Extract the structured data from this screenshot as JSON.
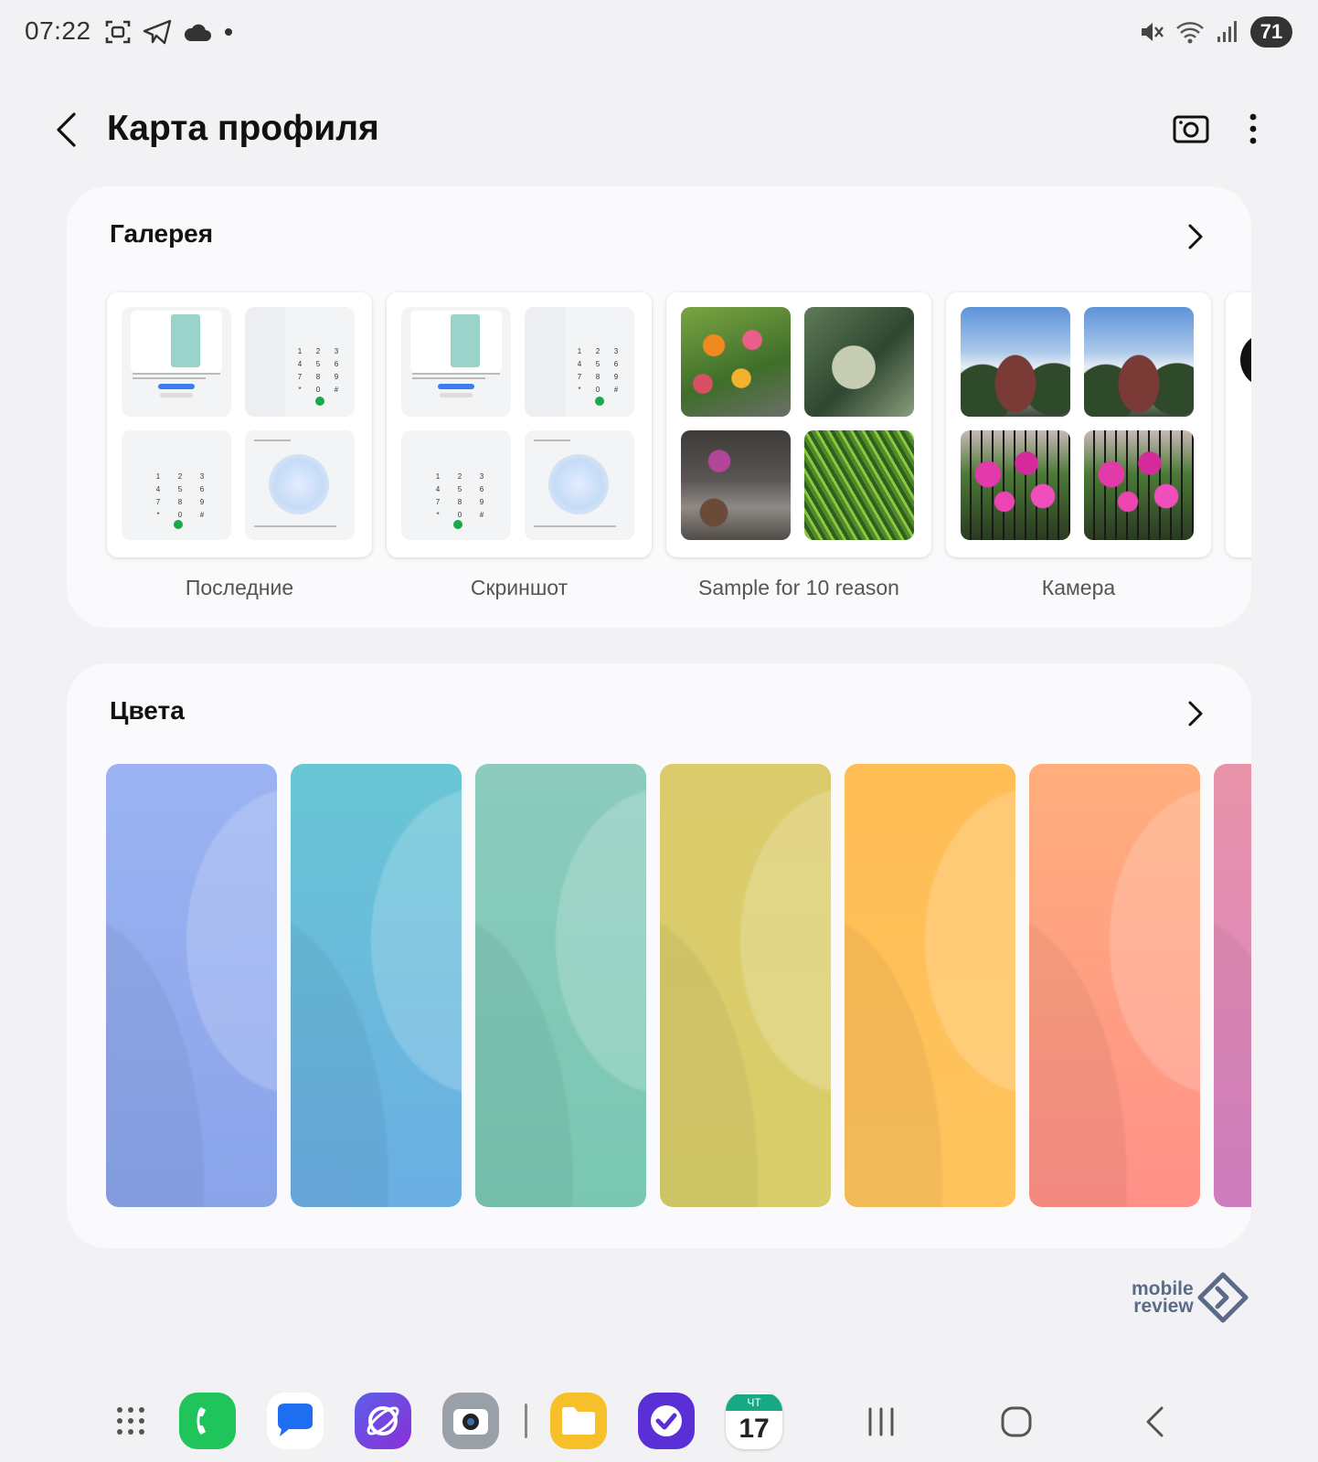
{
  "status_bar": {
    "time": "07:22",
    "left_icons": [
      "screenshot-icon",
      "telegram-icon",
      "cloud-icon",
      "dot-icon"
    ],
    "right_icons": [
      "mute-icon",
      "wifi-icon",
      "signal-icon"
    ],
    "battery": "71"
  },
  "header": {
    "title": "Карта профиля"
  },
  "gallery": {
    "title": "Галерея",
    "albums": [
      {
        "label": "Последние"
      },
      {
        "label": "Скриншот"
      },
      {
        "label": "Sample for 10 reason"
      },
      {
        "label": "Камера"
      }
    ]
  },
  "colors": {
    "title": "Цвета",
    "swatches": [
      {
        "name": "periwinkle",
        "top": "#9bb3f2",
        "bottom": "#8aa4ea"
      },
      {
        "name": "sky-teal",
        "top": "#69c6d4",
        "bottom": "#6aaee4"
      },
      {
        "name": "mint",
        "top": "#8ccbbd",
        "bottom": "#79c7b2"
      },
      {
        "name": "olive-yellow",
        "top": "#dccb6c",
        "bottom": "#d8ce6a"
      },
      {
        "name": "orange",
        "top": "#ffbd55",
        "bottom": "#ffc45e"
      },
      {
        "name": "coral",
        "top": "#ffae7c",
        "bottom": "#ff9088"
      },
      {
        "name": "pink-edge",
        "top": "#e893a8",
        "bottom": "#d983c8"
      }
    ]
  },
  "watermark": {
    "line1": "mobile",
    "line2": "review"
  },
  "dock": {
    "calendar_day_label": "ЧТ",
    "calendar_day": "17",
    "apps": [
      "apps-grid-icon",
      "phone-app-icon",
      "messages-app-icon",
      "internet-app-icon",
      "camera-app-icon",
      "files-app-icon",
      "tasks-app-icon",
      "calendar-app-icon"
    ],
    "nav": [
      "recents-nav-icon",
      "home-nav-icon",
      "back-nav-icon"
    ]
  },
  "accent_colors": {
    "phone_green": "#1fc45a",
    "messages_blue": "#1f6df0",
    "tasks_purple": "#5a2fd6",
    "files_yellow": "#f7c02a"
  }
}
